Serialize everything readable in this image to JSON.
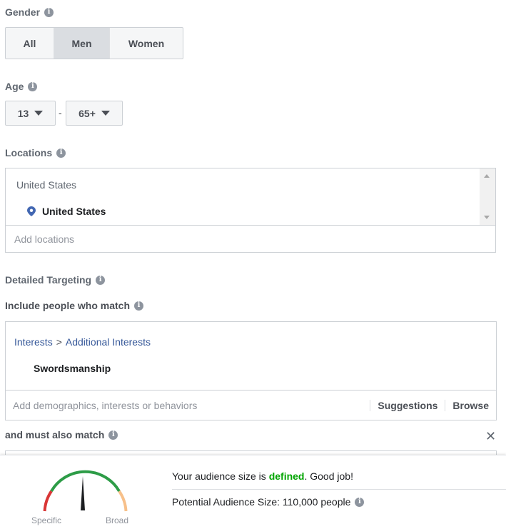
{
  "gender": {
    "label": "Gender",
    "options": [
      "All",
      "Men",
      "Women"
    ],
    "selected": "Men"
  },
  "age": {
    "label": "Age",
    "min": "13",
    "max": "65+",
    "separator": "-"
  },
  "locations": {
    "label": "Locations",
    "header": "United States",
    "items": [
      "United States"
    ],
    "placeholder": "Add locations"
  },
  "detailed_targeting": {
    "label": "Detailed Targeting",
    "include_label": "Include people who match",
    "breadcrumb": [
      "Interests",
      ">",
      "Additional Interests"
    ],
    "items": [
      "Swordsmanship"
    ],
    "placeholder": "Add demographics, interests or behaviors",
    "suggestions_label": "Suggestions",
    "browse_label": "Browse",
    "must_also_label": "and must also match",
    "close_symbol": "✕"
  },
  "audience": {
    "line1_prefix": "Your audience size is ",
    "line1_status": "defined",
    "line1_suffix": ". Good job!",
    "potential_label": "Potential Audience Size: 110,000 people",
    "gauge_left_label": "Specific",
    "gauge_right_label": "Broad"
  },
  "colors": {
    "defined_green": "#00a400",
    "gauge_red": "#d93636",
    "gauge_green": "#2d9c47",
    "gauge_orange": "#f7c08a",
    "link_blue": "#365899"
  }
}
